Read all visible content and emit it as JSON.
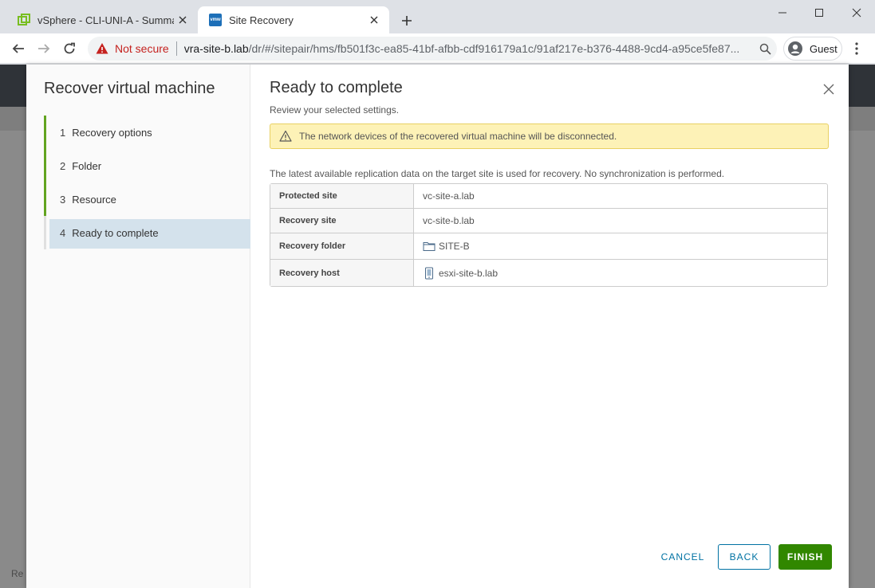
{
  "browser": {
    "tabs": [
      {
        "title": "vSphere - CLI-UNI-A - Summary",
        "favicon": "vsphere-icon",
        "active": false
      },
      {
        "title": "Site Recovery",
        "favicon": "vmw-icon",
        "active": true
      }
    ],
    "security_label": "Not secure",
    "url_host": "vra-site-b.lab",
    "url_path": "/dr/#/sitepair/hms/fb501f3c-ea85-41bf-afbb-cdf916179a1c/91af217e-b376-4488-9cd4-a95ce5fe87...",
    "profile_label": "Guest",
    "favicon_vmw_text": "vmw"
  },
  "background_page": {
    "ghost_text": "Re"
  },
  "wizard": {
    "title": "Recover virtual machine",
    "steps": [
      {
        "num": "1",
        "label": "Recovery options"
      },
      {
        "num": "2",
        "label": "Folder"
      },
      {
        "num": "3",
        "label": "Resource"
      },
      {
        "num": "4",
        "label": "Ready to complete"
      }
    ],
    "current_step": 4
  },
  "content": {
    "title": "Ready to complete",
    "subtitle": "Review your selected settings.",
    "warning": "The network devices of the recovered virtual machine will be disconnected.",
    "info": "The latest available replication data on the target site is used for recovery. No synchronization is performed.",
    "details": [
      {
        "key": "Protected site",
        "value": "vc-site-a.lab",
        "icon": ""
      },
      {
        "key": "Recovery site",
        "value": "vc-site-b.lab",
        "icon": ""
      },
      {
        "key": "Recovery folder",
        "value": "SITE-B",
        "icon": "folder-icon"
      },
      {
        "key": "Recovery host",
        "value": "esxi-site-b.lab",
        "icon": "host-icon"
      }
    ]
  },
  "buttons": {
    "cancel": "CANCEL",
    "back": "BACK",
    "finish": "FINISH"
  },
  "colors": {
    "step_accent": "#62a420",
    "finish_bg": "#318700",
    "link_blue": "#0072a3",
    "warning_bg": "#fdf2b7",
    "not_secure_red": "#c5221f"
  }
}
